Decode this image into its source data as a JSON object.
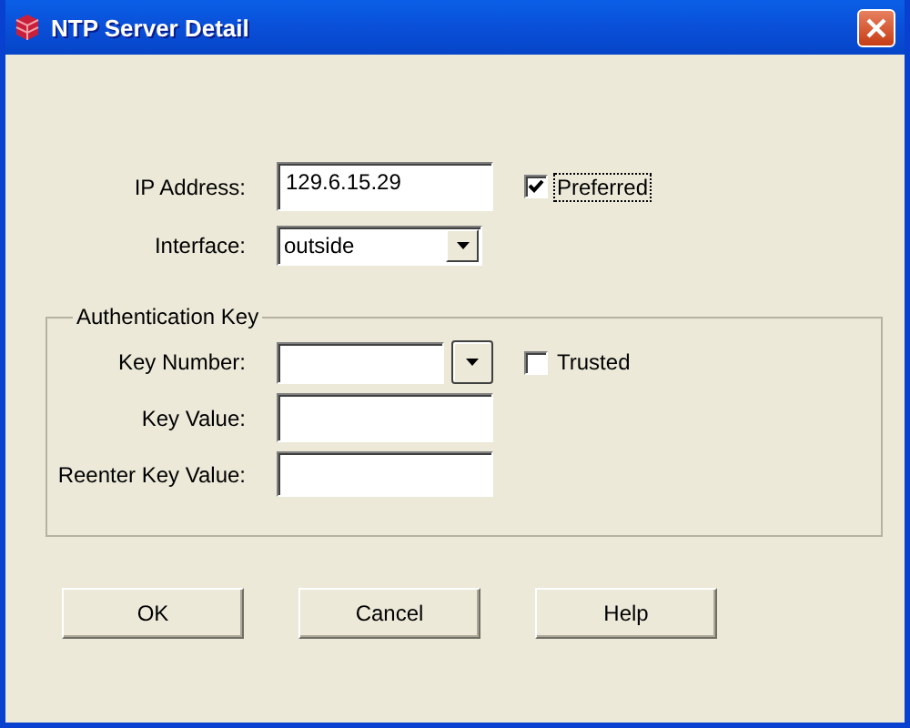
{
  "window": {
    "title": "NTP Server Detail"
  },
  "ip_address": {
    "label": "IP Address:",
    "value": "129.6.15.29"
  },
  "preferred": {
    "label": "Preferred",
    "checked": true,
    "focused": true
  },
  "interface": {
    "label": "Interface:",
    "value": "outside"
  },
  "authentication": {
    "legend": "Authentication Key",
    "key_number": {
      "label": "Key Number:"
    },
    "trusted": {
      "label": "Trusted",
      "checked": false,
      "focused": false
    },
    "key_value": {
      "label": "Key Value:"
    },
    "reenter_key_value": {
      "label": "Reenter Key Value:"
    }
  },
  "buttons": [
    {
      "label": "OK"
    },
    {
      "label": "Cancel"
    },
    {
      "label": "Help"
    }
  ]
}
